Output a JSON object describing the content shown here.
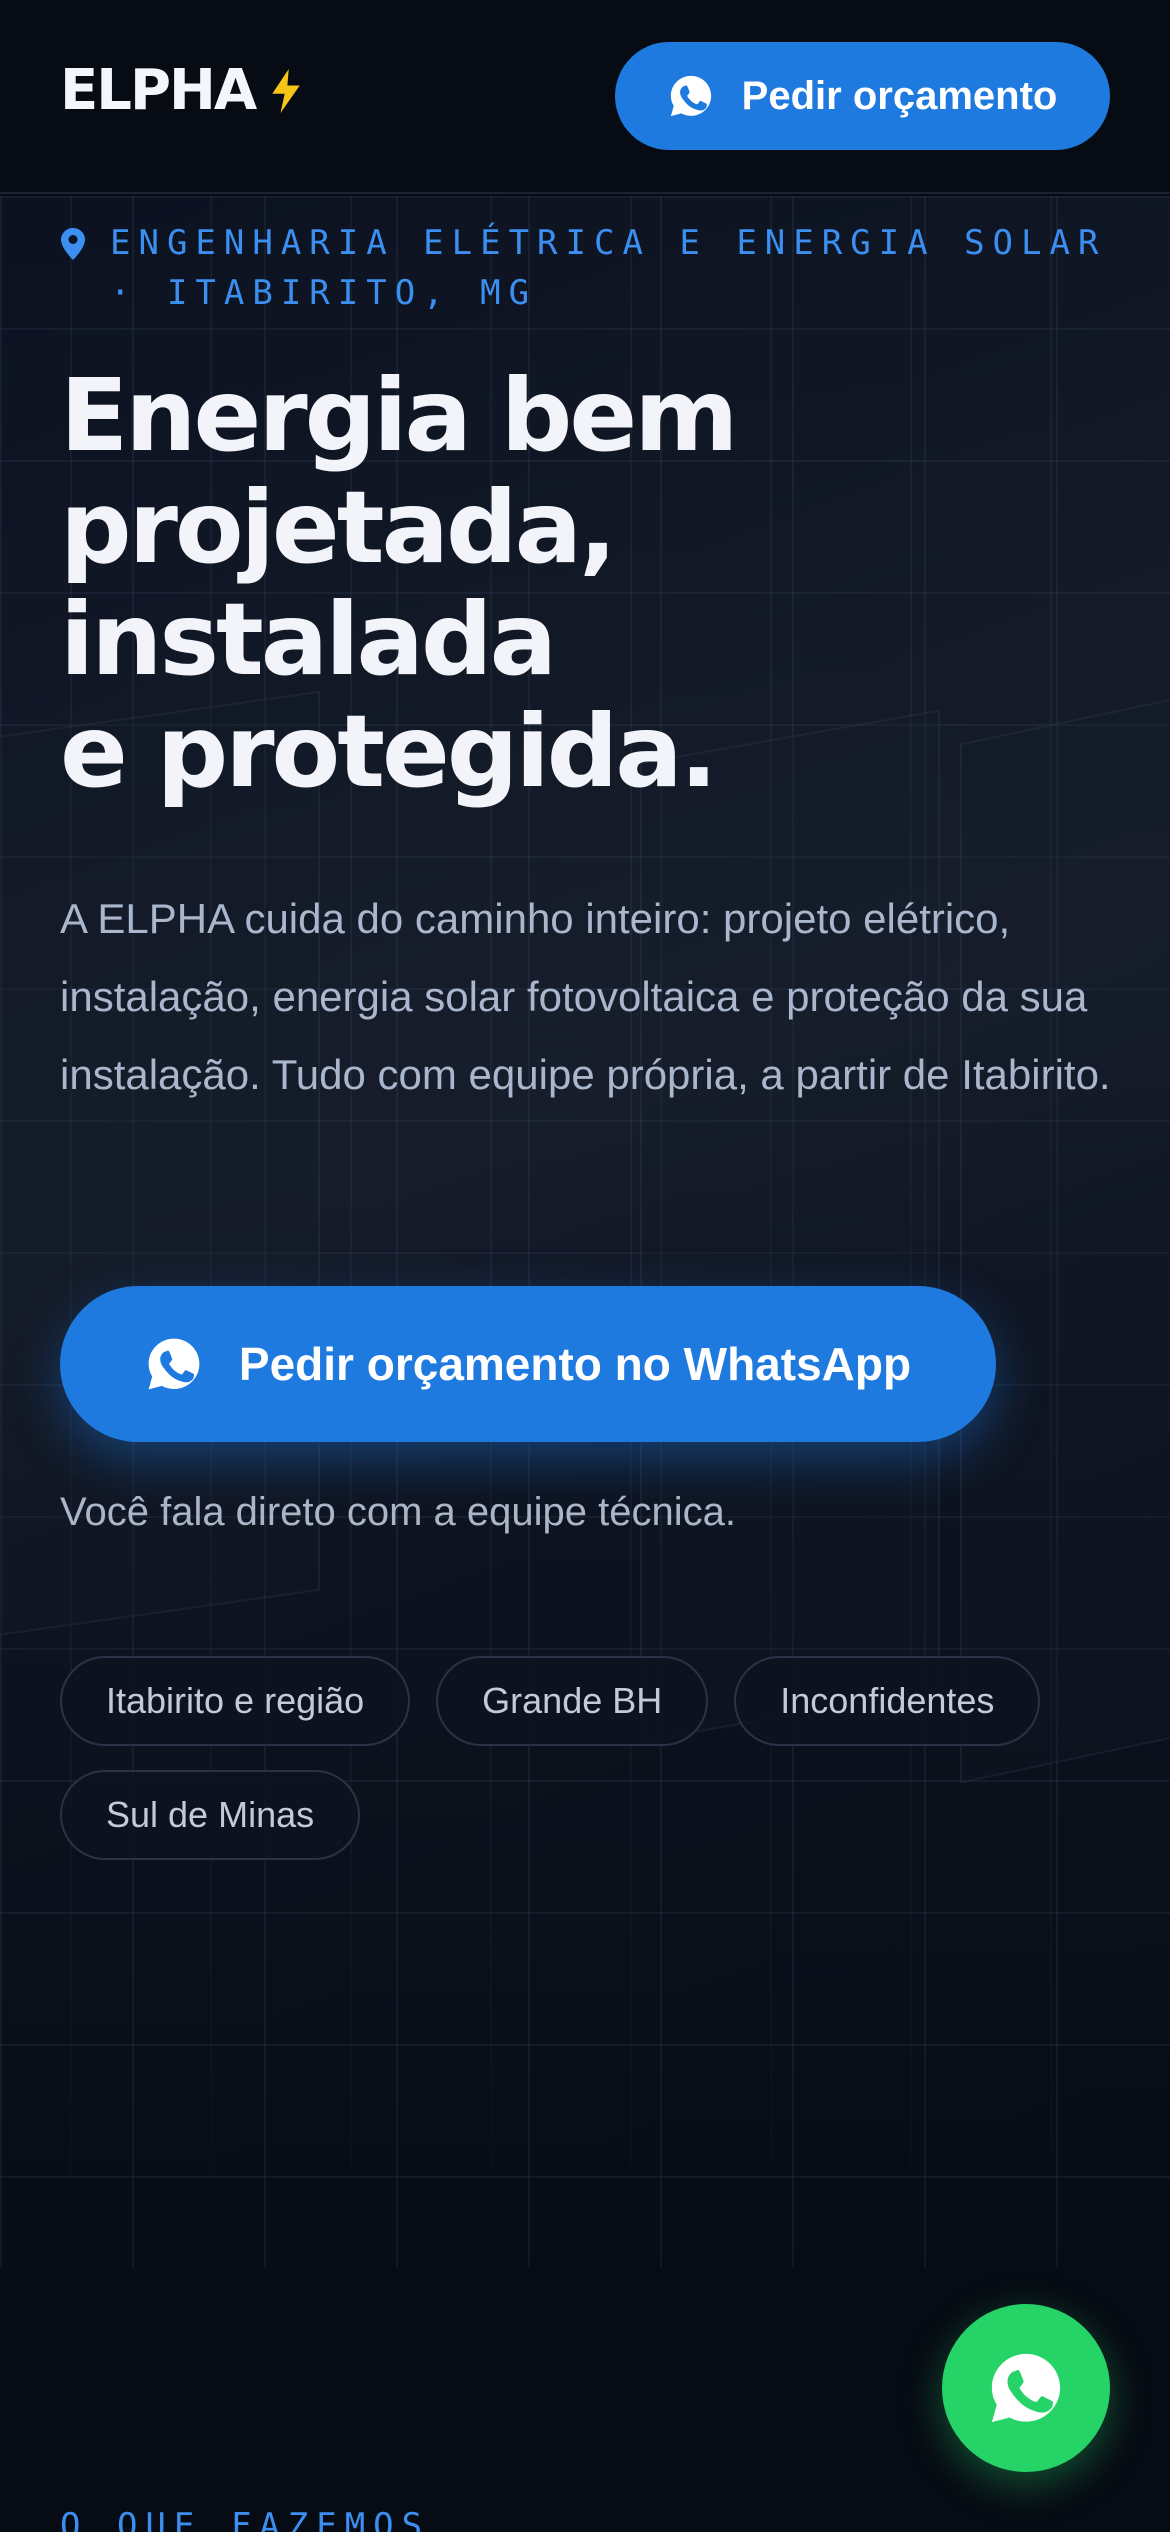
{
  "header": {
    "logo": "ELPHA",
    "logo_icon": "lightning-bolt-icon",
    "cta_label": "Pedir orçamento",
    "cta_icon": "whatsapp-icon"
  },
  "hero": {
    "eyebrow_icon": "location-pin-icon",
    "eyebrow": "Engenharia elétrica e energia solar · Itabirito, MG",
    "headline_lines": [
      "Energia bem",
      "projetada,",
      "instalada",
      "e protegida."
    ],
    "lead": "A ELPHA cuida do caminho inteiro: projeto elétrico, instalação, energia solar fotovoltaica e proteção da sua instalação. Tudo com equipe própria, a partir de Itabirito.",
    "cta_label": "Pedir orçamento no WhatsApp",
    "cta_note": "Você fala direto com a equipe técnica.",
    "regions": [
      "Itabirito e região",
      "Grande BH",
      "Inconfidentes",
      "Sul de Minas"
    ]
  },
  "next_section": {
    "label": "O QUE FAZEMOS"
  },
  "floating_button": {
    "icon": "whatsapp-icon"
  },
  "colors": {
    "background": "#070b14",
    "accent": "#1f7ae0",
    "eyebrow": "#3b8ff0",
    "whatsapp": "#25d366",
    "bolt": "#f5c518"
  }
}
